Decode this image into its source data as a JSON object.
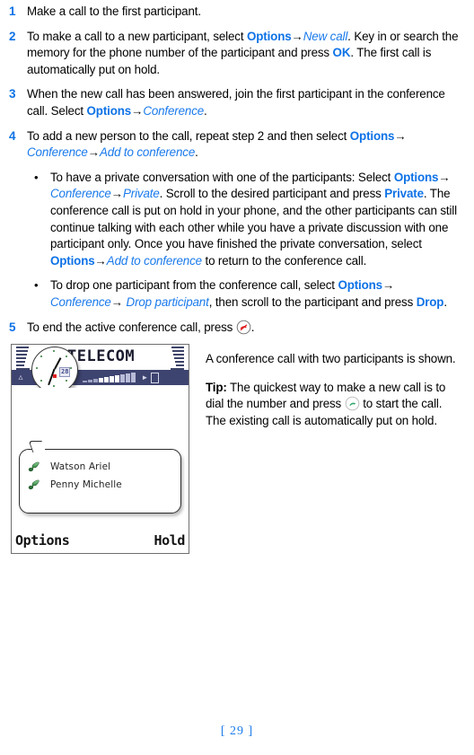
{
  "document": {
    "page_number": "[ 29 ]"
  },
  "steps": [
    {
      "number": "1",
      "segments": [
        {
          "type": "text",
          "text": "Make a call to the first participant."
        }
      ]
    },
    {
      "number": "2",
      "segments": [
        {
          "type": "text",
          "text": "To make a call to a new participant, select "
        },
        {
          "type": "bold",
          "text": "Options"
        },
        {
          "type": "arrow",
          "text": "→"
        },
        {
          "type": "italic",
          "text": "New call"
        },
        {
          "type": "text",
          "text": ". Key in or search the memory for the phone number of the participant and press "
        },
        {
          "type": "bold",
          "text": "OK"
        },
        {
          "type": "text",
          "text": ". The first call is automatically put on hold."
        }
      ]
    },
    {
      "number": "3",
      "segments": [
        {
          "type": "text",
          "text": "When the new call has been answered, join the first participant in the conference call. Select "
        },
        {
          "type": "bold",
          "text": "Options"
        },
        {
          "type": "arrow",
          "text": "→"
        },
        {
          "type": "italic",
          "text": "Conference"
        },
        {
          "type": "text",
          "text": "."
        }
      ]
    },
    {
      "number": "4",
      "segments": [
        {
          "type": "text",
          "text": "To add a new person to the call, repeat step 2 and then select "
        },
        {
          "type": "bold",
          "text": "Options"
        },
        {
          "type": "arrow",
          "text": "→ "
        },
        {
          "type": "italic",
          "text": "Conference"
        },
        {
          "type": "arrow",
          "text": "→"
        },
        {
          "type": "italic",
          "text": "Add to conference"
        },
        {
          "type": "text",
          "text": "."
        }
      ]
    }
  ],
  "bullets": [
    {
      "marker": "•",
      "segments": [
        {
          "type": "text",
          "text": "To have a private conversation with one of the participants: Select "
        },
        {
          "type": "bold",
          "text": "Options"
        },
        {
          "type": "arrow",
          "text": "→ "
        },
        {
          "type": "italic",
          "text": "Conference"
        },
        {
          "type": "arrow",
          "text": "→"
        },
        {
          "type": "italic",
          "text": "Private"
        },
        {
          "type": "text",
          "text": ". Scroll to the desired participant and press "
        },
        {
          "type": "bold",
          "text": "Private"
        },
        {
          "type": "text",
          "text": ". The conference call is put on hold in your phone, and the other participants can still continue talking with each other while you have a private discussion with one participant only. Once you have finished the private conversation, select "
        },
        {
          "type": "bold",
          "text": "Options"
        },
        {
          "type": "arrow",
          "text": "→"
        },
        {
          "type": "italic",
          "text": "Add to conference"
        },
        {
          "type": "text",
          "text": " to return to the conference call."
        }
      ]
    },
    {
      "marker": "•",
      "segments": [
        {
          "type": "text",
          "text": "To drop one participant from the conference call, select "
        },
        {
          "type": "bold",
          "text": "Options"
        },
        {
          "type": "arrow",
          "text": "→ "
        },
        {
          "type": "italic",
          "text": "Conference"
        },
        {
          "type": "arrow",
          "text": "→ "
        },
        {
          "type": "italic",
          "text": "Drop participant"
        },
        {
          "type": "text",
          "text": ", then scroll to the participant and press "
        },
        {
          "type": "bold",
          "text": "Drop"
        },
        {
          "type": "text",
          "text": "."
        }
      ]
    }
  ],
  "final_step": {
    "number": "5",
    "text_before": "To end the active conference call, press ",
    "icon": "end-call-icon",
    "text_after": "."
  },
  "phone_figure": {
    "operator_name": "TELECOM",
    "date_badge": "28",
    "status_icons": {
      "antenna": "antenna-icon",
      "left_arrow": "◀",
      "volume": "speaker-icon",
      "right_arrow": "▶",
      "battery": "battery-icon"
    },
    "call_list": [
      {
        "icon": "handset-icon",
        "name": "Watson Ariel"
      },
      {
        "icon": "handset-icon",
        "name": "Penny Michelle"
      }
    ],
    "softkeys": {
      "left": "Options",
      "right": "Hold"
    }
  },
  "figure_caption": {
    "description": "A conference call with two participants is shown.",
    "tip_label": "Tip:",
    "tip_before": " The quickest way to make a new call is to dial the number and press ",
    "tip_icon": "call-icon",
    "tip_after": " to start the call. The existing call is automatically put on hold."
  },
  "colors": {
    "link_blue": "#0d72e6",
    "italic_blue": "#1a7aeb",
    "phone_band": "#3e4470",
    "end_call_red": "#e02020",
    "call_green": "#2fa86a"
  }
}
